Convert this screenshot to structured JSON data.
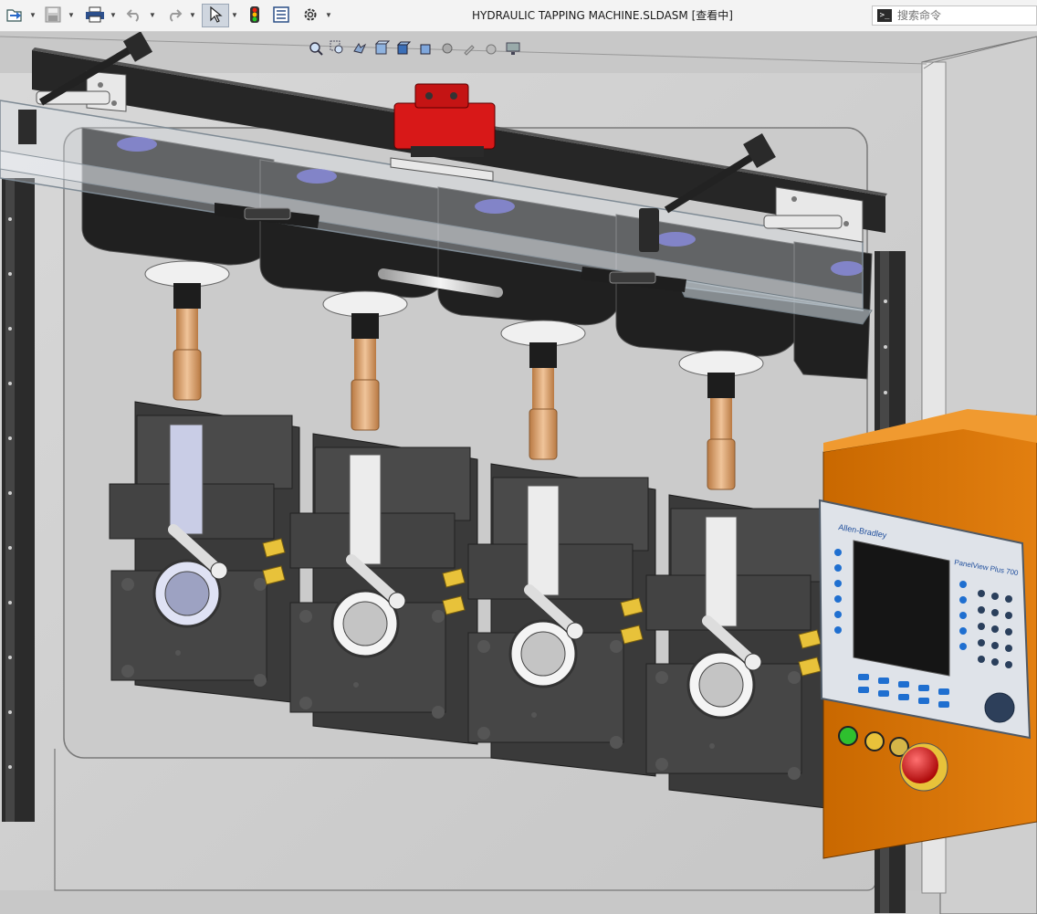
{
  "window": {
    "title": "HYDRAULIC TAPPING MACHINE.SLDASM [查看中]"
  },
  "search": {
    "placeholder": "搜索命令",
    "value": ""
  },
  "toolbar": {
    "items": [
      {
        "name": "open-icon"
      },
      {
        "name": "save-icon"
      },
      {
        "name": "print-icon"
      },
      {
        "name": "undo-icon"
      },
      {
        "name": "redo-icon"
      },
      {
        "name": "select-pointer-icon"
      },
      {
        "name": "rebuild-traffic-light-icon"
      },
      {
        "name": "file-properties-icon"
      },
      {
        "name": "options-gear-icon"
      }
    ]
  },
  "view_toolbar": {
    "items": [
      {
        "name": "zoom-to-fit-icon"
      },
      {
        "name": "zoom-to-area-icon"
      },
      {
        "name": "previous-view-icon"
      },
      {
        "name": "section-view-icon"
      },
      {
        "name": "view-orientation-icon"
      },
      {
        "name": "display-style-icon"
      },
      {
        "name": "hide-show-items-icon"
      },
      {
        "name": "edit-appearance-icon"
      },
      {
        "name": "apply-scene-icon"
      },
      {
        "name": "view-settings-icon"
      }
    ]
  },
  "colors": {
    "panel": "#d6d6d6",
    "machine_dark": "#3c3c3c",
    "copper": "#d9a070",
    "orange_cabinet": "#e07800",
    "red_accent": "#d81818",
    "hmi_frame": "#e2e6ec",
    "hmi_accent": "#1f6fd0",
    "brass": "#e8c23a"
  },
  "hmi": {
    "brand": "Allen-Bradley",
    "model": "PanelView Plus 700"
  }
}
